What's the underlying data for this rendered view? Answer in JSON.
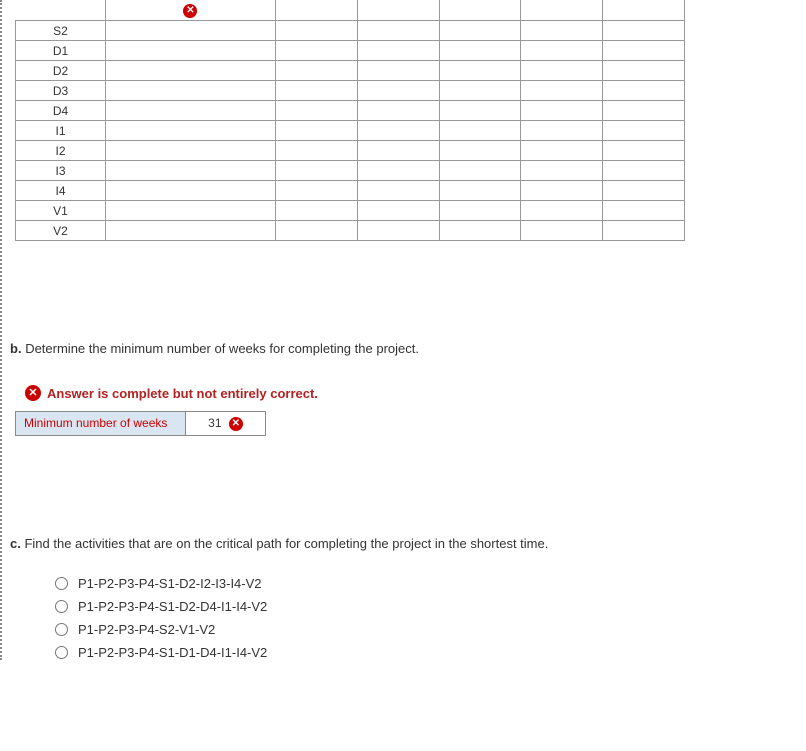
{
  "table_rows": [
    "S2",
    "D1",
    "D2",
    "D3",
    "D4",
    "I1",
    "I2",
    "I3",
    "I4",
    "V1",
    "V2"
  ],
  "section_b": {
    "letter": "b.",
    "text": "Determine the minimum number of weeks for completing the project."
  },
  "banner": "Answer is complete but not entirely correct.",
  "answer_box": {
    "label": "Minimum number of weeks",
    "value": "31"
  },
  "section_c": {
    "letter": "c.",
    "text": "Find the activities that are on the critical path for completing the project in the shortest time."
  },
  "options": [
    "P1-P2-P3-P4-S1-D2-I2-I3-I4-V2",
    "P1-P2-P3-P4-S1-D2-D4-I1-I4-V2",
    "P1-P2-P3-P4-S2-V1-V2",
    "P1-P2-P3-P4-S1-D1-D4-I1-I4-V2"
  ]
}
